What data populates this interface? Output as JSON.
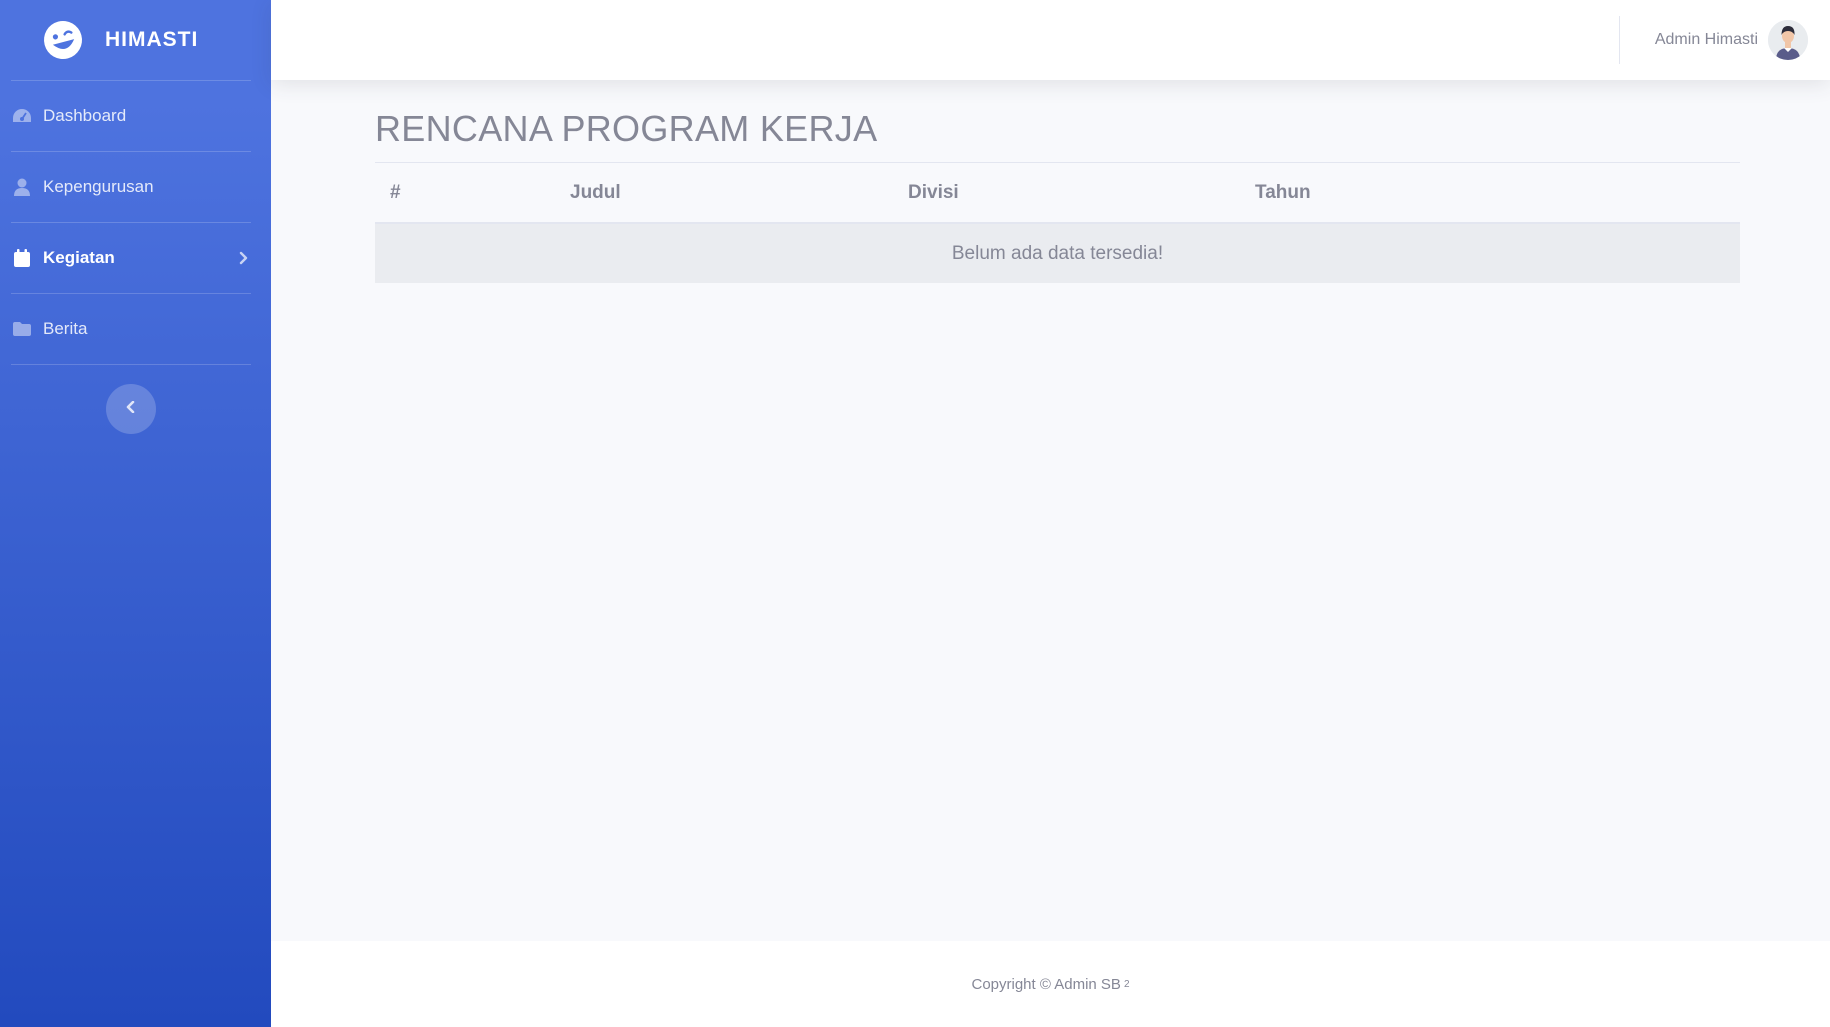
{
  "brand": {
    "name": "HIMASTI",
    "icon": "laugh-wink-icon"
  },
  "sidebar": {
    "items": [
      {
        "label": "Dashboard",
        "icon": "tachometer-icon",
        "active": false
      },
      {
        "label": "Kepengurusan",
        "icon": "user-icon",
        "active": false
      },
      {
        "label": "Kegiatan",
        "icon": "calendar-icon",
        "active": true,
        "has_submenu": true
      },
      {
        "label": "Berita",
        "icon": "folder-icon",
        "active": false
      }
    ],
    "toggle_icon": "chevron-left-icon"
  },
  "topbar": {
    "user_name": "Admin Himasti",
    "avatar_icon": "user-avatar"
  },
  "main": {
    "title": "RENCANA PROGRAM KERJA",
    "table": {
      "columns": [
        "#",
        "Judul",
        "Divisi",
        "Tahun"
      ],
      "empty_message": "Belum ada data tersedia!"
    }
  },
  "footer": {
    "copyright": "Copyright © Admin SB",
    "superscript": "2"
  },
  "colors": {
    "sidebar_top": "#4e73df",
    "sidebar_bottom": "#224abe",
    "text_muted": "#858796",
    "page_bg": "#f8f9fc"
  }
}
